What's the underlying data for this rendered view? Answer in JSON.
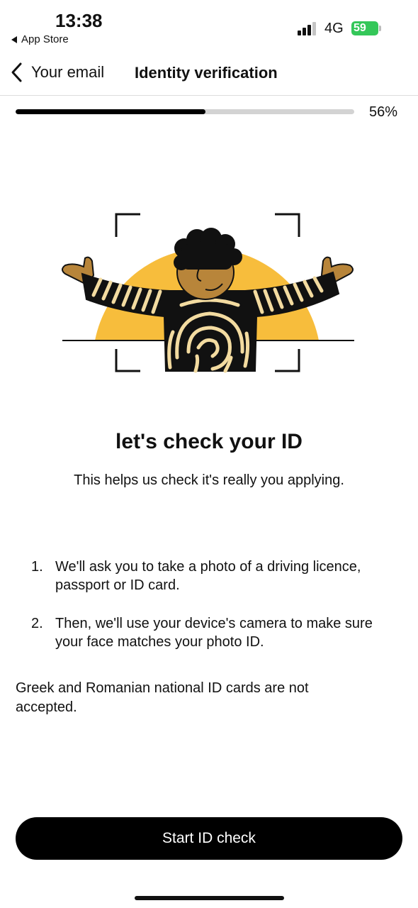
{
  "status_bar": {
    "time": "13:38",
    "back_app": "App Store",
    "network": "4G",
    "battery": "59"
  },
  "nav": {
    "back_label": "Your email",
    "title": "Identity verification"
  },
  "progress": {
    "value": 0.56,
    "label": "56%"
  },
  "content": {
    "headline": "let's check your ID",
    "subtitle": "This helps us check it's really you applying.",
    "steps": [
      {
        "number": "1.",
        "text": "We'll ask you to take a photo of a driving licence, passport or ID card."
      },
      {
        "number": "2.",
        "text": "Then, we'll use your device's camera to make sure your face matches your photo ID."
      }
    ],
    "note": "Greek and Romanian national ID cards are not accepted."
  },
  "cta": {
    "label": "Start ID check"
  },
  "colors": {
    "sun": "#f7bd3c",
    "skin": "#b8853a",
    "stripe": "#f3dba0",
    "button": "#000000",
    "battery": "#34c759"
  }
}
